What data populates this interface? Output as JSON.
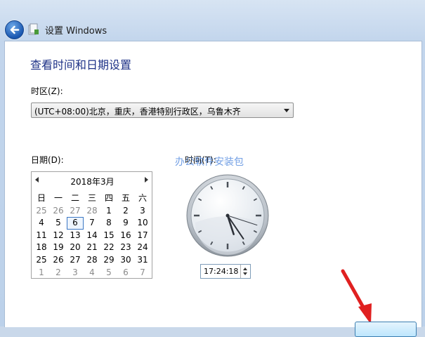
{
  "window": {
    "title": "设置 Windows"
  },
  "page": {
    "heading": "查看时间和日期设置"
  },
  "timezone": {
    "label": "时区(Z):",
    "value": "(UTC+08:00)北京，重庆，香港特别行政区，乌鲁木齐"
  },
  "date": {
    "label": "日期(D):"
  },
  "time": {
    "label": "时间(T):",
    "value": "17:24:18",
    "hour": 17,
    "minute": 24,
    "second": 18
  },
  "calendar": {
    "month_title": "2018年3月",
    "weekdays": [
      "日",
      "一",
      "二",
      "三",
      "四",
      "五",
      "六"
    ],
    "weeks": [
      [
        {
          "d": "25",
          "o": true
        },
        {
          "d": "26",
          "o": true
        },
        {
          "d": "27",
          "o": true
        },
        {
          "d": "28",
          "o": true
        },
        {
          "d": "1"
        },
        {
          "d": "2"
        },
        {
          "d": "3"
        }
      ],
      [
        {
          "d": "4"
        },
        {
          "d": "5"
        },
        {
          "d": "6",
          "today": true
        },
        {
          "d": "7"
        },
        {
          "d": "8"
        },
        {
          "d": "9"
        },
        {
          "d": "10"
        }
      ],
      [
        {
          "d": "11"
        },
        {
          "d": "12"
        },
        {
          "d": "13"
        },
        {
          "d": "14"
        },
        {
          "d": "15"
        },
        {
          "d": "16"
        },
        {
          "d": "17"
        }
      ],
      [
        {
          "d": "18"
        },
        {
          "d": "19"
        },
        {
          "d": "20"
        },
        {
          "d": "21"
        },
        {
          "d": "22"
        },
        {
          "d": "23"
        },
        {
          "d": "24"
        }
      ],
      [
        {
          "d": "25"
        },
        {
          "d": "26"
        },
        {
          "d": "27"
        },
        {
          "d": "28"
        },
        {
          "d": "29"
        },
        {
          "d": "30"
        },
        {
          "d": "31"
        }
      ],
      [
        {
          "d": "1",
          "o": true
        },
        {
          "d": "2",
          "o": true
        },
        {
          "d": "3",
          "o": true
        },
        {
          "d": "4",
          "o": true
        },
        {
          "d": "5",
          "o": true
        },
        {
          "d": "6",
          "o": true
        },
        {
          "d": "7",
          "o": true
        }
      ]
    ]
  },
  "watermark": "办公软件安装包",
  "colors": {
    "heading": "#1e3287",
    "accent_arrow": "#e02020",
    "today_border": "#3b77c4"
  }
}
